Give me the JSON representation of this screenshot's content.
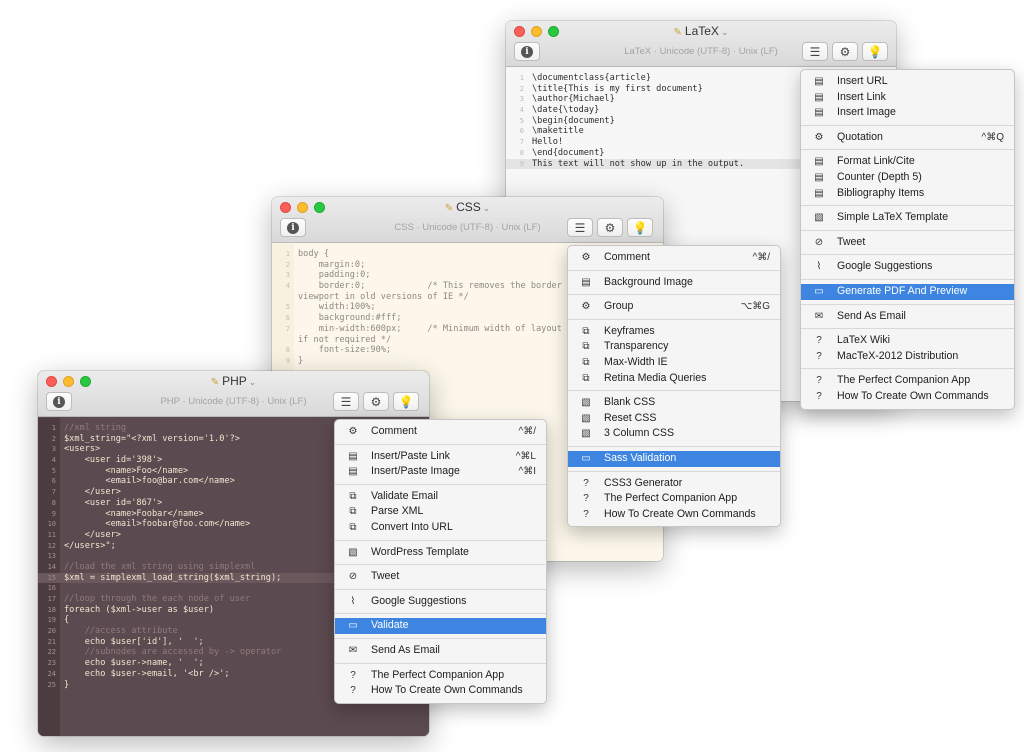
{
  "latex": {
    "title": "LaTeX",
    "subtitle": "LaTeX · Unicode (UTF-8) · Unix (LF)",
    "code": [
      "\\documentclass{article}",
      "\\title{This is my first document}",
      "\\author{Michael}",
      "\\date{\\today}",
      "\\begin{document}",
      "\\maketitle",
      "Hello!",
      "\\end{document}",
      "This text will not show up in the output."
    ],
    "menu": [
      {
        "icon": "doc",
        "label": "Insert URL",
        "shortcut": ""
      },
      {
        "icon": "doc",
        "label": "Insert Link",
        "shortcut": ""
      },
      {
        "icon": "doc",
        "label": "Insert Image",
        "shortcut": ""
      },
      {
        "sep": true
      },
      {
        "icon": "gear",
        "label": "Quotation",
        "shortcut": "^⌘Q"
      },
      {
        "sep": true
      },
      {
        "icon": "doc",
        "label": "Format Link/Cite",
        "shortcut": ""
      },
      {
        "icon": "doc",
        "label": "Counter (Depth 5)",
        "shortcut": ""
      },
      {
        "icon": "doc",
        "label": "Bibliography Items",
        "shortcut": ""
      },
      {
        "sep": true
      },
      {
        "icon": "template",
        "label": "Simple LaTeX Template",
        "shortcut": ""
      },
      {
        "sep": true
      },
      {
        "icon": "compass",
        "label": "Tweet",
        "shortcut": ""
      },
      {
        "sep": true
      },
      {
        "icon": "clip",
        "label": "Google Suggestions",
        "shortcut": ""
      },
      {
        "sep": true
      },
      {
        "icon": "terminal",
        "label": "Generate PDF And Preview",
        "shortcut": "",
        "selected": true
      },
      {
        "sep": true
      },
      {
        "icon": "mail",
        "label": "Send As Email",
        "shortcut": ""
      },
      {
        "sep": true
      },
      {
        "icon": "help",
        "label": "LaTeX Wiki",
        "shortcut": ""
      },
      {
        "icon": "help",
        "label": "MacTeX-2012 Distribution",
        "shortcut": ""
      },
      {
        "sep": true
      },
      {
        "icon": "help",
        "label": "The Perfect Companion App",
        "shortcut": ""
      },
      {
        "icon": "help",
        "label": "How To Create Own Commands",
        "shortcut": ""
      }
    ]
  },
  "css": {
    "title": "CSS",
    "subtitle": "CSS · Unicode (UTF-8) · Unix (LF)",
    "code": [
      "body {",
      "    margin:0;",
      "    padding:0;",
      "    border:0;            /* This removes the border",
      "viewport in old versions of IE */",
      "    width:100%;",
      "    background:#fff;",
      "    min-width:600px;     /* Minimum width of layout",
      "if not required */",
      "    font-size:90%;",
      "}"
    ],
    "line_numbers": [
      "1",
      "2",
      "3",
      "4",
      "",
      "5",
      "6",
      "7",
      "",
      "8",
      "9"
    ],
    "menu": [
      {
        "icon": "gear",
        "label": "Comment",
        "shortcut": "^⌘/"
      },
      {
        "sep": true
      },
      {
        "icon": "doc",
        "label": "Background Image",
        "shortcut": ""
      },
      {
        "sep": true
      },
      {
        "icon": "gear",
        "label": "Group",
        "shortcut": "⌥⌘G"
      },
      {
        "sep": true
      },
      {
        "icon": "snippet",
        "label": "Keyframes",
        "shortcut": ""
      },
      {
        "icon": "snippet",
        "label": "Transparency",
        "shortcut": ""
      },
      {
        "icon": "snippet",
        "label": "Max-Width IE",
        "shortcut": ""
      },
      {
        "icon": "snippet",
        "label": "Retina Media Queries",
        "shortcut": ""
      },
      {
        "sep": true
      },
      {
        "icon": "template",
        "label": "Blank CSS",
        "shortcut": ""
      },
      {
        "icon": "template",
        "label": "Reset CSS",
        "shortcut": ""
      },
      {
        "icon": "template",
        "label": "3 Column CSS",
        "shortcut": ""
      },
      {
        "sep": true
      },
      {
        "icon": "terminal",
        "label": "Sass Validation",
        "shortcut": "",
        "selected": true
      },
      {
        "sep": true
      },
      {
        "icon": "help",
        "label": "CSS3 Generator",
        "shortcut": ""
      },
      {
        "icon": "help",
        "label": "The Perfect Companion App",
        "shortcut": ""
      },
      {
        "icon": "help",
        "label": "How To Create Own Commands",
        "shortcut": ""
      }
    ]
  },
  "php": {
    "title": "PHP",
    "subtitle": "PHP · Unicode (UTF-8) · Unix (LF)",
    "code": [
      {
        "t": "//xml string",
        "c": true
      },
      {
        "t": "$xml_string=\"<?xml version='1.0'?>",
        "c": false
      },
      {
        "t": "<users>",
        "c": false
      },
      {
        "t": "    <user id='398'>",
        "c": false
      },
      {
        "t": "        <name>Foo</name>",
        "c": false
      },
      {
        "t": "        <email>foo@bar.com</name>",
        "c": false
      },
      {
        "t": "    </user>",
        "c": false
      },
      {
        "t": "    <user id='867'>",
        "c": false
      },
      {
        "t": "        <name>Foobar</name>",
        "c": false
      },
      {
        "t": "        <email>foobar@foo.com</name>",
        "c": false
      },
      {
        "t": "    </user>",
        "c": false
      },
      {
        "t": "</users>\";",
        "c": false
      },
      {
        "t": "",
        "c": false
      },
      {
        "t": "//load the xml string using simplexml",
        "c": true
      },
      {
        "t": "$xml = simplexml_load_string($xml_string);",
        "c": false,
        "hl": true
      },
      {
        "t": "",
        "c": false
      },
      {
        "t": "//loop through the each node of user",
        "c": true
      },
      {
        "t": "foreach ($xml->user as $user)",
        "c": false
      },
      {
        "t": "{",
        "c": false
      },
      {
        "t": "    //access attribute",
        "c": true
      },
      {
        "t": "    echo $user['id'], '  ';",
        "c": false
      },
      {
        "t": "    //subnodes are accessed by -> operator",
        "c": true
      },
      {
        "t": "    echo $user->name, '  ';",
        "c": false
      },
      {
        "t": "    echo $user->email, '<br />';",
        "c": false
      },
      {
        "t": "}",
        "c": false
      }
    ],
    "menu": [
      {
        "icon": "gear",
        "label": "Comment",
        "shortcut": "^⌘/"
      },
      {
        "sep": true
      },
      {
        "icon": "doc",
        "label": "Insert/Paste Link",
        "shortcut": "^⌘L"
      },
      {
        "icon": "doc",
        "label": "Insert/Paste Image",
        "shortcut": "^⌘I"
      },
      {
        "sep": true
      },
      {
        "icon": "snippet",
        "label": "Validate Email",
        "shortcut": ""
      },
      {
        "icon": "snippet",
        "label": "Parse XML",
        "shortcut": ""
      },
      {
        "icon": "snippet",
        "label": "Convert Into URL",
        "shortcut": ""
      },
      {
        "sep": true
      },
      {
        "icon": "template",
        "label": "WordPress Template",
        "shortcut": ""
      },
      {
        "sep": true
      },
      {
        "icon": "compass",
        "label": "Tweet",
        "shortcut": ""
      },
      {
        "sep": true
      },
      {
        "icon": "clip",
        "label": "Google Suggestions",
        "shortcut": ""
      },
      {
        "sep": true
      },
      {
        "icon": "terminal",
        "label": "Validate",
        "shortcut": "",
        "selected": true
      },
      {
        "sep": true
      },
      {
        "icon": "mail",
        "label": "Send As Email",
        "shortcut": ""
      },
      {
        "sep": true
      },
      {
        "icon": "help",
        "label": "The Perfect Companion App",
        "shortcut": ""
      },
      {
        "icon": "help",
        "label": "How To Create Own Commands",
        "shortcut": ""
      }
    ]
  },
  "icons": {
    "doc": "doc-icon",
    "gear": "gear-icon",
    "template": "template-icon",
    "compass": "compass-icon",
    "clip": "paperclip-icon",
    "terminal": "terminal-icon",
    "mail": "mail-icon",
    "help": "help-icon",
    "snippet": "snippet-icon"
  },
  "colors": {
    "selection": "#3d85e0",
    "php_bg": "#5b4a4f",
    "css_bg": "#fcf7ea",
    "latex_bg": "#f7f7f7"
  }
}
